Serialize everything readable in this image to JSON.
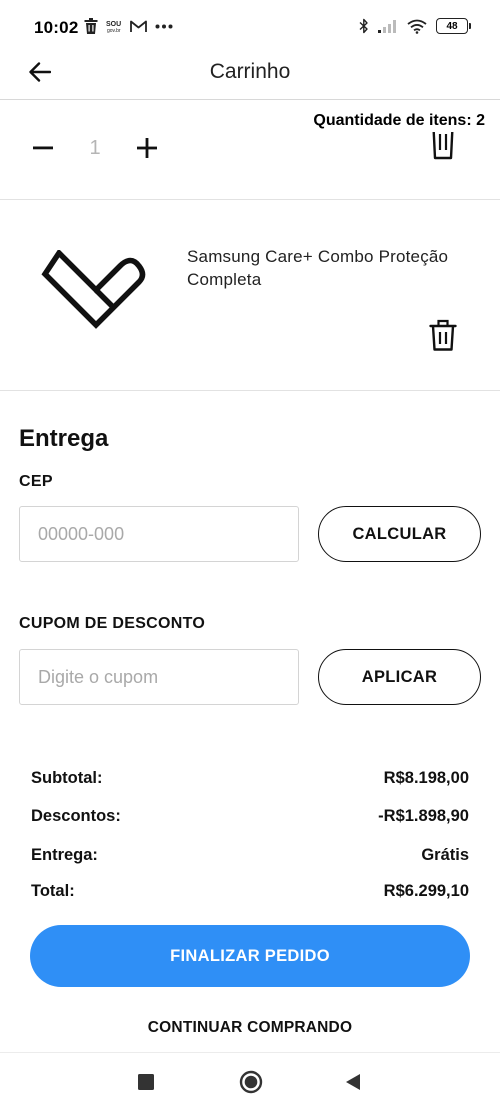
{
  "status_bar": {
    "time": "10:02",
    "left_icons": [
      "trash-icon",
      "sou-gov-icon",
      "gmail-icon",
      "more-dots-icon"
    ],
    "battery": "48",
    "right_icons": [
      "bluetooth-icon",
      "signal-icon",
      "wifi-icon",
      "battery-icon"
    ]
  },
  "header": {
    "title": "Carrinho",
    "back_icon": "arrow-left-icon"
  },
  "cart": {
    "items_count_label": "Quantidade de itens: 2",
    "items": [
      {
        "quantity": "1",
        "decrement_icon": "minus-icon",
        "increment_icon": "plus-icon",
        "remove_icon": "trash-icon"
      },
      {
        "name": "Samsung Care+ Combo Proteção Completa",
        "logo_icon": "samsung-care-heart-icon",
        "remove_icon": "trash-icon"
      }
    ]
  },
  "delivery": {
    "title": "Entrega",
    "cep_label": "CEP",
    "cep_placeholder": "00000-000",
    "cep_value": "",
    "calculate_label": "CALCULAR",
    "coupon_label": "CUPOM DE DESCONTO",
    "coupon_placeholder": "Digite o cupom",
    "coupon_value": "",
    "apply_label": "APLICAR"
  },
  "summary": {
    "subtotal_label": "Subtotal:",
    "subtotal_value": "R$8.198,00",
    "discounts_label": "Descontos:",
    "discounts_value": "-R$1.898,90",
    "shipping_label": "Entrega:",
    "shipping_value": "Grátis",
    "total_label": "Total:",
    "total_value": "R$6.299,10"
  },
  "actions": {
    "checkout_label": "FINALIZAR PEDIDO",
    "continue_label": "CONTINUAR COMPRANDO"
  },
  "colors": {
    "primary": "#2f8ff6",
    "text": "#111111",
    "placeholder": "#a9a9a9",
    "divider": "#e2e2e2"
  },
  "nav_bar": {
    "icons": [
      "recents-square-icon",
      "home-circle-icon",
      "back-triangle-icon"
    ]
  }
}
